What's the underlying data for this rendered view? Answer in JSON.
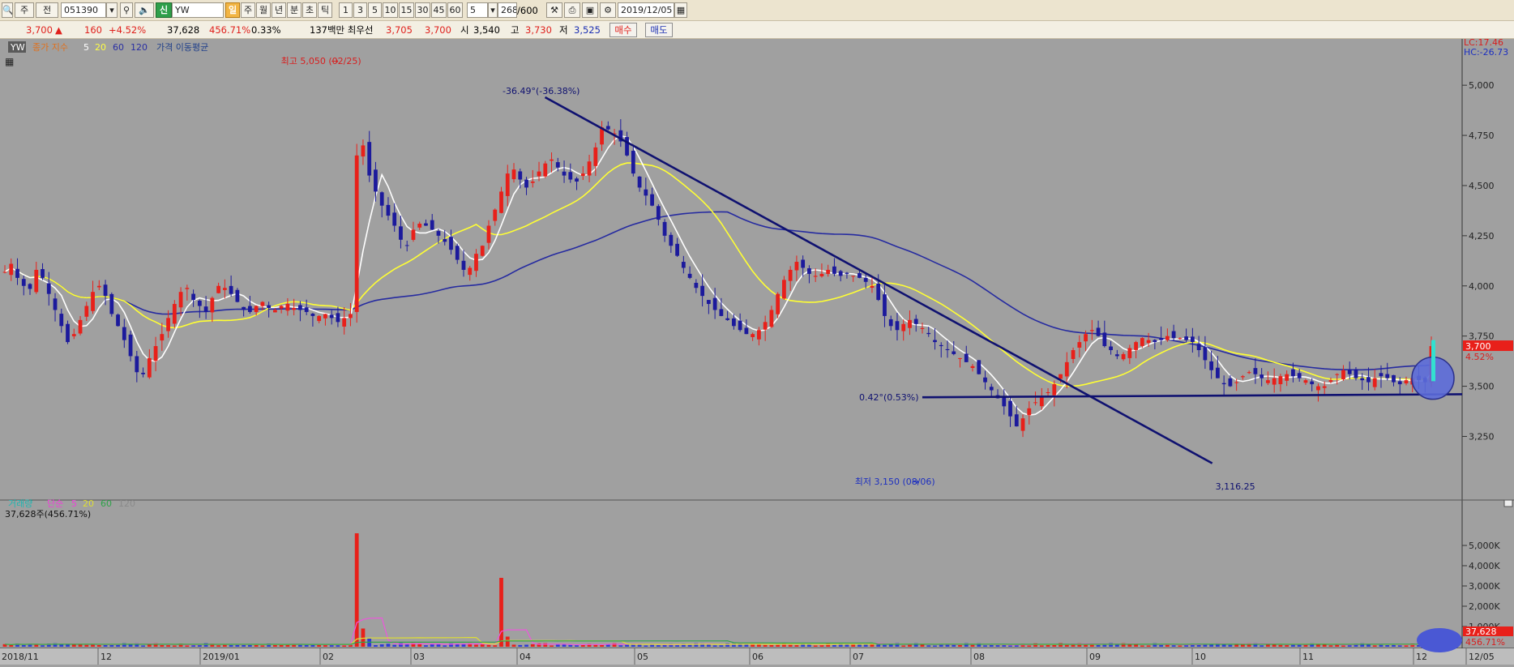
{
  "toolbar": {
    "market": "주",
    "mode": "전",
    "code": "051390",
    "name": "YW",
    "name_badge": "신",
    "period_buttons": [
      "일",
      "주",
      "월",
      "년",
      "분",
      "초",
      "틱"
    ],
    "active_period": "일",
    "interval_buttons": [
      "1",
      "3",
      "5",
      "10",
      "15",
      "30",
      "45",
      "60"
    ],
    "interval_value": "5",
    "count_value": "268",
    "count_total": "/600",
    "date": "2019/12/05"
  },
  "quote": {
    "price": "3,700",
    "change": "160",
    "change_pct": "+4.52%",
    "volume": "37,628",
    "volume_pct": "456.71%",
    "turnover": "0.33%",
    "best_label": "137백만 최우선",
    "ask": "3,705",
    "bid": "3,700",
    "open_label": "시",
    "open": "3,540",
    "high_label": "고",
    "high": "3,730",
    "low_label": "저",
    "low": "3,525",
    "buy_label": "매수",
    "sell_label": "매도"
  },
  "colors": {
    "background": "#a0a0a0",
    "up_candle": "#e8201a",
    "down_candle": "#1c1a9c",
    "ma5": "#ffffff",
    "ma20": "#ffff33",
    "ma60": "#262ba0",
    "trendline": "#0f1170",
    "volume_up": "#e8201a",
    "volume_down": "#2d3bd6"
  },
  "chart_data": [
    {
      "type": "candlestick",
      "legend": {
        "stock_name": "YW",
        "indicator_label": "종가 지수",
        "periods": [
          "5",
          "20",
          "60",
          "120"
        ],
        "ma_label": "가격 이동평균"
      },
      "y_ticks": [
        "5,000",
        "4,750",
        "4,500",
        "4,250",
        "4,000",
        "3,750",
        "3,500",
        "3,250"
      ],
      "ylim": [
        3050,
        5150
      ],
      "x_labels": [
        "2018/11",
        "12",
        "2019/01",
        "02",
        "03",
        "04",
        "05",
        "06",
        "07",
        "08",
        "09",
        "10",
        "11",
        "12",
        "12/05"
      ],
      "lc_label": "LC:17.46",
      "hc_label": "HC:-26.73",
      "last_price_label": "3,700",
      "last_change_label": "4.52%",
      "annotations": {
        "high": "최고 5,050 (02/25)",
        "low": "최저 3,150 (08/06)",
        "trend_angle": "-36.49°(-36.38%)",
        "trend_end_value": "3,116.25",
        "support_angle": "0.42°(0.53%)"
      },
      "close": [
        4070,
        4110,
        4040,
        4000,
        3985,
        4080,
        4040,
        3960,
        3880,
        3800,
        3720,
        3760,
        3830,
        3900,
        3970,
        4000,
        3950,
        3860,
        3800,
        3730,
        3650,
        3570,
        3560,
        3640,
        3700,
        3760,
        3840,
        3910,
        3970,
        3990,
        3930,
        3900,
        3870,
        3940,
        4000,
        3990,
        3960,
        3920,
        3880,
        3870,
        3900,
        3920,
        3890,
        3880,
        3900,
        3910,
        3890,
        3880,
        3870,
        3850,
        3850,
        3860,
        3840,
        3820,
        3840,
        3860,
        4650,
        4700,
        4550,
        4470,
        4400,
        4350,
        4300,
        4230,
        4200,
        4280,
        4310,
        4300,
        4280,
        4250,
        4220,
        4180,
        4130,
        4080,
        4090,
        4160,
        4200,
        4300,
        4380,
        4470,
        4560,
        4580,
        4530,
        4490,
        4520,
        4570,
        4610,
        4630,
        4590,
        4550,
        4530,
        4520,
        4560,
        4620,
        4690,
        4790,
        4780,
        4760,
        4720,
        4650,
        4560,
        4490,
        4450,
        4400,
        4330,
        4250,
        4200,
        4150,
        4090,
        4040,
        3990,
        3950,
        3910,
        3880,
        3850,
        3830,
        3800,
        3780,
        3760,
        3760,
        3780,
        3820,
        3880,
        3960,
        4030,
        4080,
        4120,
        4090,
        4060,
        4050,
        4060,
        4080,
        4060,
        4050,
        4060,
        4050,
        4040,
        4020,
        4000,
        3930,
        3850,
        3800,
        3780,
        3810,
        3830,
        3810,
        3790,
        3760,
        3720,
        3700,
        3680,
        3660,
        3640,
        3620,
        3600,
        3560,
        3520,
        3480,
        3440,
        3400,
        3350,
        3300,
        3340,
        3390,
        3420,
        3450,
        3470,
        3510,
        3560,
        3620,
        3680,
        3720,
        3760,
        3780,
        3750,
        3700,
        3680,
        3650,
        3660,
        3690,
        3720,
        3740,
        3730,
        3720,
        3730,
        3750,
        3740,
        3740,
        3730,
        3720,
        3680,
        3630,
        3580,
        3540,
        3510,
        3500,
        3520,
        3550,
        3570,
        3560,
        3540,
        3530,
        3540,
        3550,
        3560,
        3550,
        3540,
        3530,
        3510,
        3500,
        3500,
        3530,
        3560,
        3580,
        3560,
        3540,
        3530,
        3520,
        3540,
        3550,
        3540,
        3520,
        3510,
        3530,
        3540,
        3530,
        3520,
        3700
      ]
    },
    {
      "type": "bar",
      "legend": {
        "volume_label": "거래량",
        "simple_label": "단순",
        "periods": [
          "5",
          "20",
          "60",
          "120"
        ],
        "current": "37,628주(456.71%)"
      },
      "y_ticks": [
        "5,000K",
        "4,000K",
        "3,000K",
        "2,000K",
        "1,000K"
      ],
      "ylim": [
        0,
        6000000
      ],
      "last_volume_label": "37,628",
      "last_volume_pct": "456.71%"
    }
  ]
}
